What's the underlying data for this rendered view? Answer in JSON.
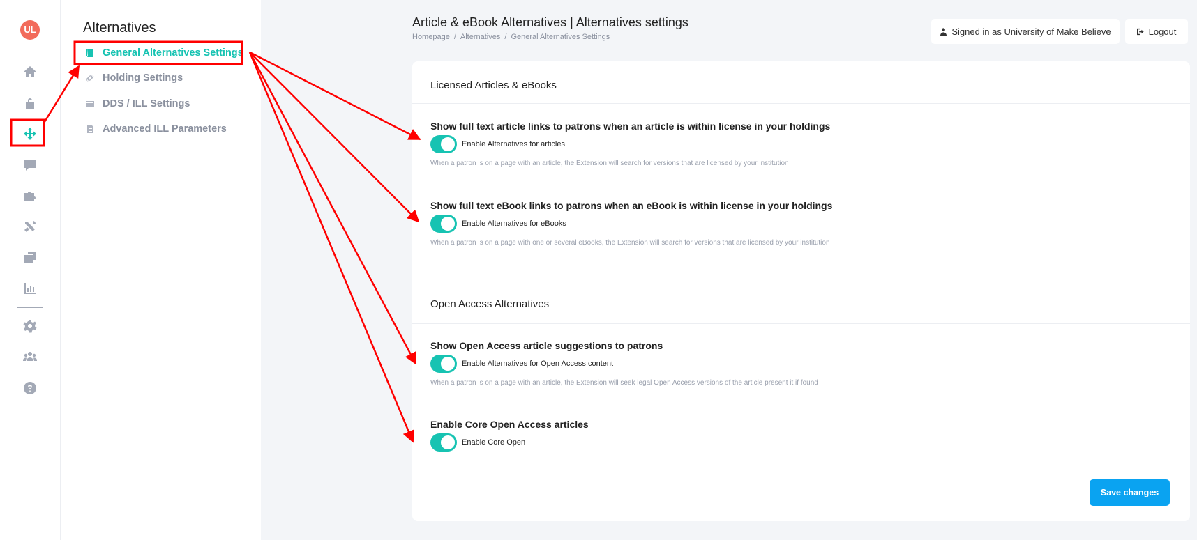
{
  "app": {
    "logo_text": "UL"
  },
  "rail": {
    "items": [
      {
        "name": "home-icon",
        "active": false
      },
      {
        "name": "unlock-icon",
        "active": false
      },
      {
        "name": "arrows-move-icon",
        "active": true
      },
      {
        "name": "chat-icon",
        "active": false
      },
      {
        "name": "puzzle-icon",
        "active": false
      },
      {
        "name": "tools-icon",
        "active": false
      },
      {
        "name": "copy-icon",
        "active": false
      },
      {
        "name": "chart-icon",
        "active": false
      },
      {
        "name": "gear-icon",
        "active": false
      },
      {
        "name": "users-icon",
        "active": false
      },
      {
        "name": "help-icon",
        "active": false
      }
    ]
  },
  "subnav": {
    "title": "Alternatives",
    "items": [
      {
        "label": "General Alternatives Settings",
        "icon": "book-icon",
        "active": true
      },
      {
        "label": "Holding Settings",
        "icon": "link-icon",
        "active": false
      },
      {
        "label": "DDS / ILL Settings",
        "icon": "card-icon",
        "active": false
      },
      {
        "label": "Advanced ILL Parameters",
        "icon": "document-icon",
        "active": false
      }
    ]
  },
  "header": {
    "title": "Article & eBook Alternatives | Alternatives settings",
    "breadcrumb": [
      "Homepage",
      "Alternatives",
      "General Alternatives Settings"
    ],
    "breadcrumb_sep": "/",
    "signed_in": "Signed in as University of Make Believe",
    "logout": "Logout"
  },
  "licensed": {
    "title": "Licensed Articles & eBooks",
    "settings": [
      {
        "title": "Show full text article links to patrons when an article is within license in your holdings",
        "toggle_label": "Enable Alternatives for articles",
        "enabled": true,
        "help": "When a patron is on a page with an article, the Extension will search for versions that are licensed by your institution"
      },
      {
        "title": "Show full text eBook links to patrons when an eBook is within license in your holdings",
        "toggle_label": "Enable Alternatives for eBooks",
        "enabled": true,
        "help": "When a patron is on a page with one or several eBooks, the Extension will search for versions that are licensed by your institution"
      }
    ]
  },
  "open_access": {
    "title": "Open Access Alternatives",
    "settings": [
      {
        "title": "Show Open Access article suggestions to patrons",
        "toggle_label": "Enable Alternatives for Open Access content",
        "enabled": true,
        "help": "When a patron is on a page with an article, the Extension will seek legal Open Access versions of the article present it if found"
      },
      {
        "title": "Enable Core Open Access articles",
        "toggle_label": "Enable Core Open",
        "enabled": true
      }
    ]
  },
  "actions": {
    "save": "Save changes"
  },
  "annotation_color": "#ff0000",
  "accent_color": "#17c3b2",
  "primary_button_color": "#0aa3f1"
}
